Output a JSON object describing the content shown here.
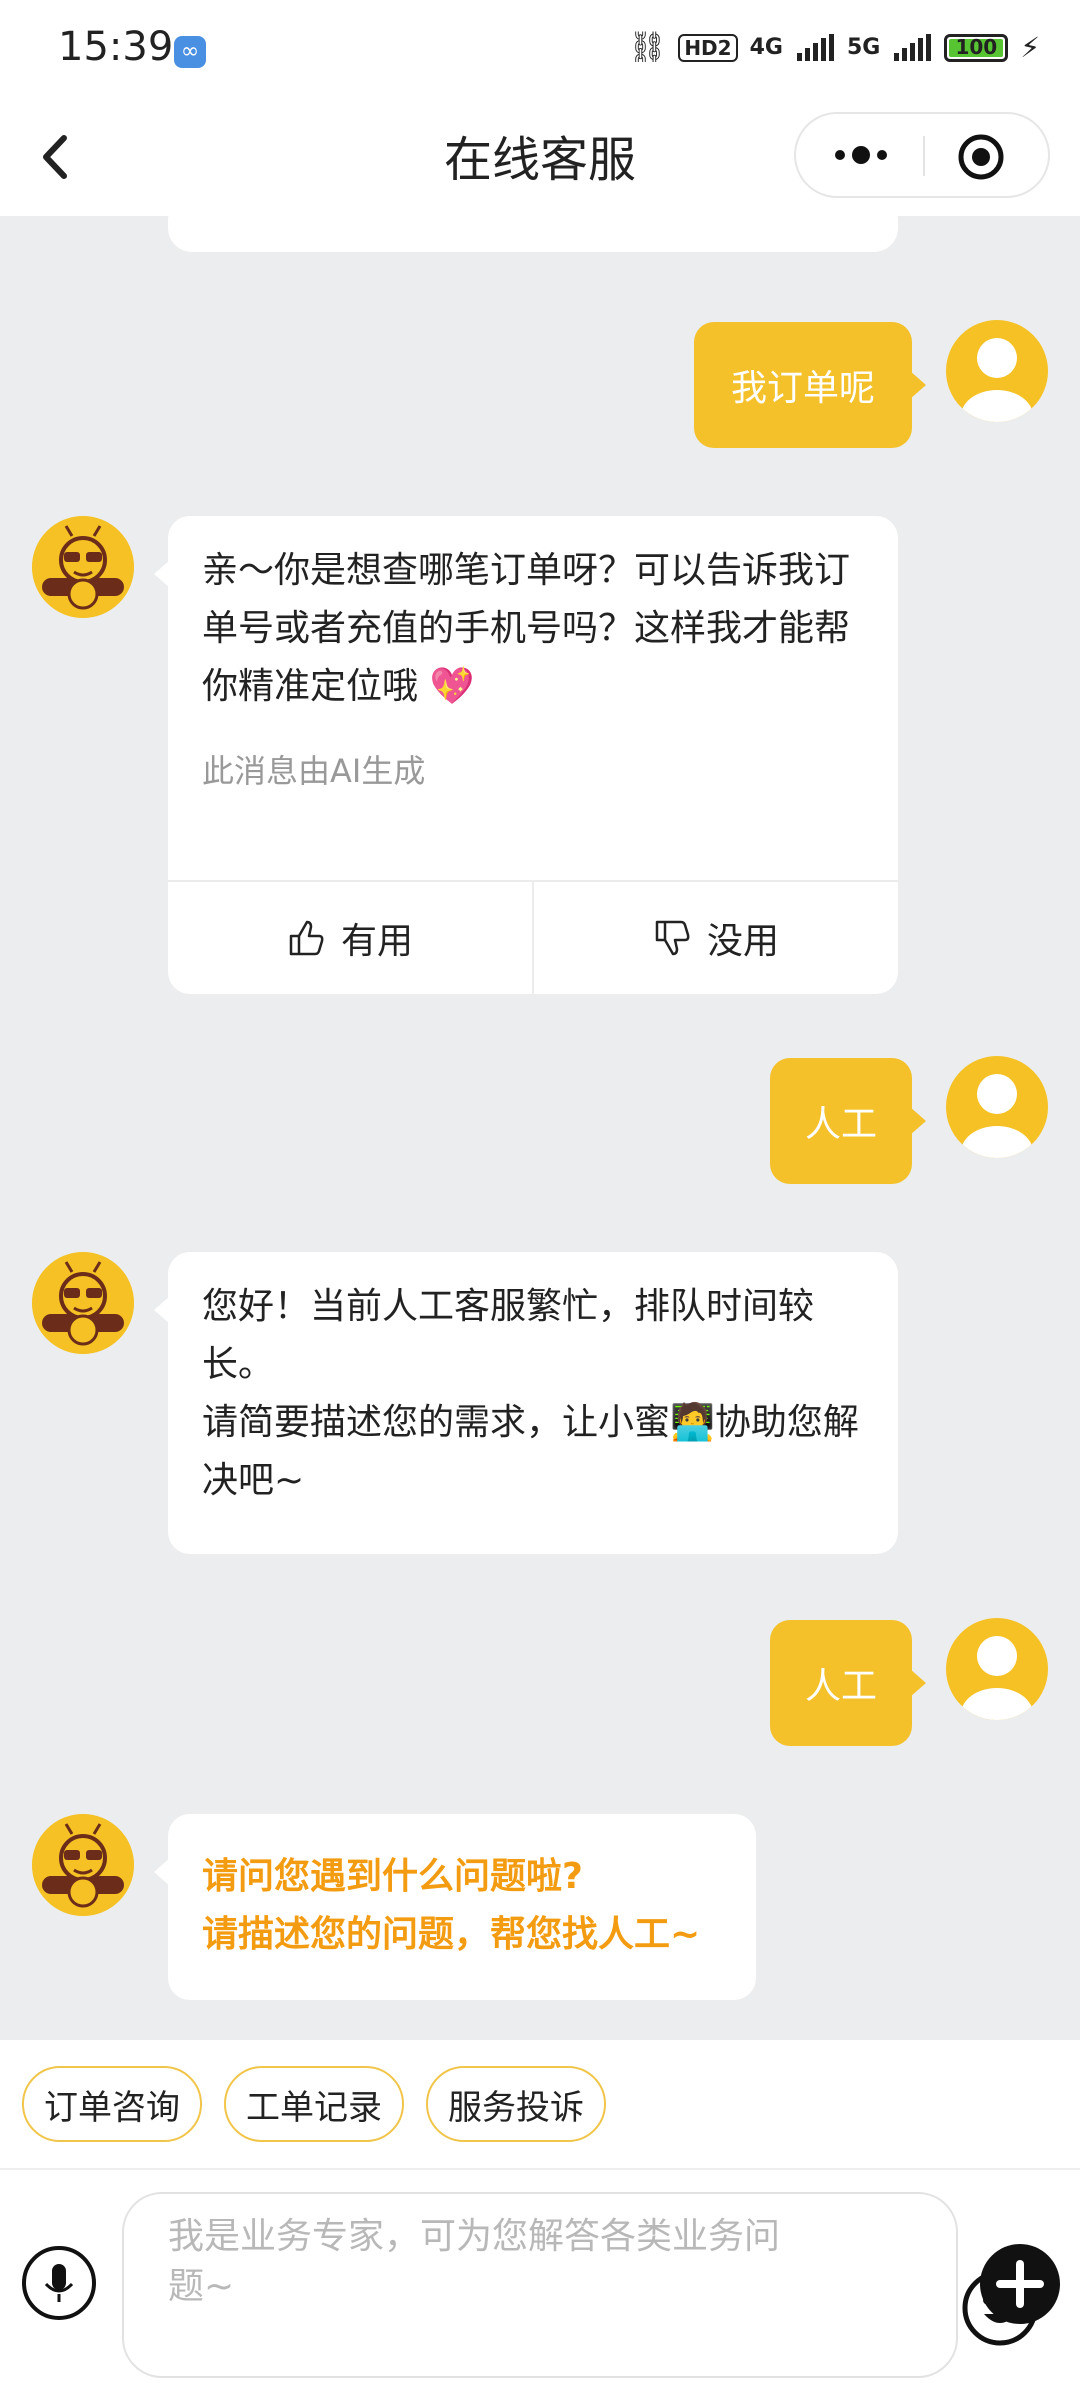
{
  "status_bar": {
    "time": "15:39",
    "hd": "HD2",
    "net1": "4G",
    "net2": "5G",
    "battery": "100"
  },
  "nav": {
    "title": "在线客服"
  },
  "messages": {
    "user1": "我订单呢",
    "bot1": {
      "text": "亲～你是想查哪笔订单呀？可以告诉我订单号或者充值的手机号吗？这样我才能帮你精准定位哦 💖",
      "ai_note": "此消息由AI生成",
      "useful": "有用",
      "useless": "没用"
    },
    "user2": "人工",
    "bot2": {
      "line1": "您好！当前人工客服繁忙，排队时间较长。",
      "line2": "请简要描述您的需求，让小蜜🧑‍💻协助您解决吧~"
    },
    "user3": "人工",
    "bot3": {
      "line1": "请问您遇到什么问题啦?",
      "line2": "请描述您的问题，帮您找人工~"
    }
  },
  "quick_actions": [
    "订单咨询",
    "工单记录",
    "服务投诉"
  ],
  "input": {
    "placeholder": "我是业务专家，可为您解答各类业务问题~"
  },
  "colors": {
    "accent": "#f4c12b",
    "orange_text": "#f39c12",
    "background": "#ecedee"
  }
}
